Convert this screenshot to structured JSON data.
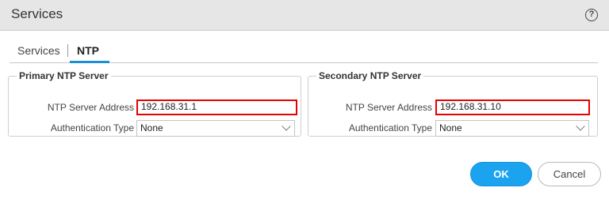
{
  "dialog": {
    "title": "Services",
    "help_icon": "?"
  },
  "tabs": [
    {
      "label": "Services",
      "active": false
    },
    {
      "label": "NTP",
      "active": true
    }
  ],
  "primary": {
    "legend": "Primary NTP Server",
    "address_label": "NTP Server Address",
    "address_value": "192.168.31.1",
    "auth_label": "Authentication Type",
    "auth_value": "None"
  },
  "secondary": {
    "legend": "Secondary NTP Server",
    "address_label": "NTP Server Address",
    "address_value": "192.168.31.10",
    "auth_label": "Authentication Type",
    "auth_value": "None"
  },
  "buttons": {
    "ok": "OK",
    "cancel": "Cancel"
  },
  "colors": {
    "accent": "#1ba3ef",
    "highlight": "#e60000",
    "titlebar": "#e6e6e6"
  }
}
